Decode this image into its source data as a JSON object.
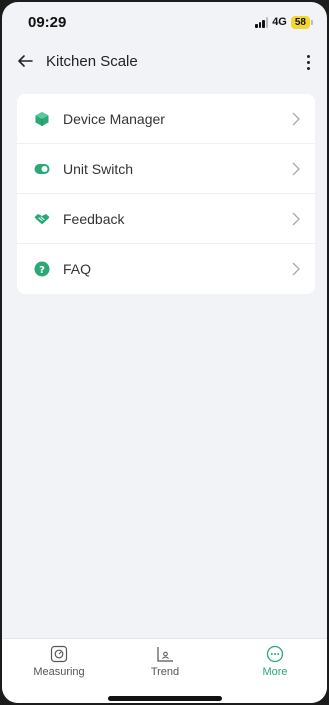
{
  "status_bar": {
    "time": "09:29",
    "network": "4G",
    "battery": "58"
  },
  "header": {
    "title": "Kitchen Scale"
  },
  "menu": {
    "items": [
      {
        "label": "Device Manager",
        "icon": "device-cube-icon"
      },
      {
        "label": "Unit Switch",
        "icon": "toggle-icon"
      },
      {
        "label": "Feedback",
        "icon": "handshake-icon"
      },
      {
        "label": "FAQ",
        "icon": "question-icon"
      }
    ]
  },
  "tabbar": {
    "tabs": [
      {
        "label": "Measuring",
        "icon": "scale-icon",
        "active": false
      },
      {
        "label": "Trend",
        "icon": "chart-icon",
        "active": false
      },
      {
        "label": "More",
        "icon": "more-dots-icon",
        "active": true
      }
    ]
  },
  "colors": {
    "accent": "#2aa876",
    "background": "#f2f3f7",
    "battery": "#f5d530"
  }
}
